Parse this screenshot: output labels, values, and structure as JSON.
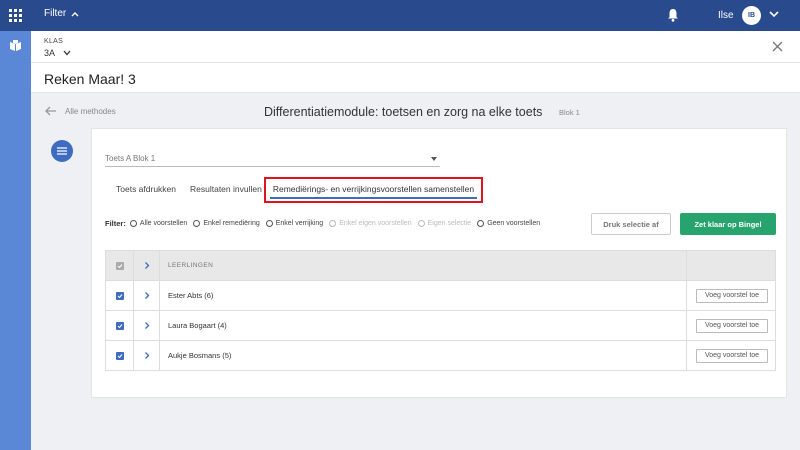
{
  "topbar": {
    "filter_label": "Filter",
    "user_name": "Ilse",
    "avatar_initials": "IB"
  },
  "klas": {
    "label": "KLAS",
    "value": "3A"
  },
  "app_title": "Reken Maar! 3",
  "nav": {
    "back_label": "Alle methodes",
    "page_title": "Differentiatiemodule: toetsen en zorg na elke toets",
    "blok": "Blok 1"
  },
  "test_select": {
    "value": "Toets A Blok 1"
  },
  "tabs": [
    {
      "label": "Toets afdrukken"
    },
    {
      "label": "Resultaten invullen"
    },
    {
      "label": "Remediërings- en verrijkingsvoorstellen samenstellen",
      "active": true
    }
  ],
  "filter": {
    "label": "Filter:",
    "options": [
      {
        "label": "Alle voorstellen",
        "disabled": false
      },
      {
        "label": "Enkel remediëring",
        "disabled": false
      },
      {
        "label": "Enkel verrijking",
        "disabled": false
      },
      {
        "label": "Enkel eigen voorstellen",
        "disabled": true
      },
      {
        "label": "Eigen selectie",
        "disabled": true
      },
      {
        "label": "Geen voorstellen",
        "disabled": false
      }
    ]
  },
  "buttons": {
    "print": "Druk selectie af",
    "ready": "Zet klaar op Bingel"
  },
  "table": {
    "header": "LEERLINGEN",
    "rows": [
      {
        "name": "Ester Abts (6)",
        "action": "Voeg voorstel toe",
        "checked": true
      },
      {
        "name": "Laura Bogaart (4)",
        "action": "Voeg voorstel toe",
        "checked": true
      },
      {
        "name": "Aukje Bosmans (5)",
        "action": "Voeg voorstel toe",
        "checked": true
      }
    ]
  },
  "colors": {
    "topbar": "#2a4a8e",
    "rail": "#5a87d6",
    "accent": "#3e6cc0",
    "green": "#27a46e",
    "highlight": "#e0141e"
  }
}
